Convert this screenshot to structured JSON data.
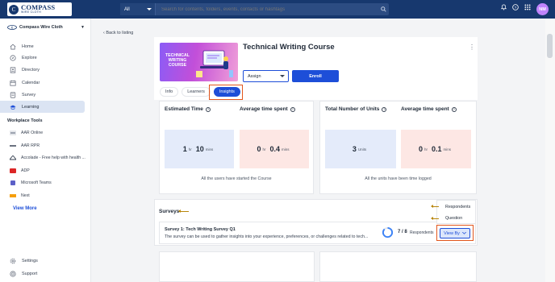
{
  "topbar": {
    "logo_text": "COMPASS",
    "logo_sub": "WIRE CLOTH",
    "search_scope": "All",
    "search_placeholder": "Search for contents, folders, events, contacts or hashtags",
    "avatar_initials": "NM"
  },
  "sidebar": {
    "org_name": "Compass Wire Cloth",
    "nav": [
      {
        "label": "Home",
        "icon": "home-icon"
      },
      {
        "label": "Explore",
        "icon": "explore-icon"
      },
      {
        "label": "Directory",
        "icon": "directory-icon"
      },
      {
        "label": "Calendar",
        "icon": "calendar-icon"
      },
      {
        "label": "Survey",
        "icon": "survey-icon"
      },
      {
        "label": "Learning",
        "icon": "learning-icon",
        "active": true
      }
    ],
    "tools_heading": "Workplace Tools",
    "tools": [
      {
        "label": "AAR Online"
      },
      {
        "label": "AAR RPR"
      },
      {
        "label": "Accolade - Free help with health ..."
      },
      {
        "label": "ADP"
      },
      {
        "label": "Microsoft Teams"
      },
      {
        "label": "Next"
      }
    ],
    "view_more": "View More",
    "settings": "Settings",
    "support": "Support"
  },
  "main": {
    "back_label": "Back to listing",
    "thumb_text": [
      "TECHNICAL",
      "WRITING",
      "COURSE"
    ],
    "course_title": "Technical Writing Course",
    "assign_label": "Assign",
    "enroll_label": "Enroll",
    "tabs": [
      "Info",
      "Learners",
      "Insights"
    ],
    "active_tab": "Insights",
    "stats_left": {
      "estimated_title": "Estimated Time",
      "estimated": {
        "h": "1",
        "h_unit": "hr",
        "m": "10",
        "m_unit": "mins"
      },
      "avg_title": "Average time spent",
      "avg": {
        "h": "0",
        "h_unit": "hr",
        "m": "0.4",
        "m_unit": "mins"
      },
      "note": "All the users have started the Course"
    },
    "stats_right": {
      "units_title": "Total Number of Units",
      "units": {
        "value": "3",
        "unit": "Units"
      },
      "avg_title": "Average time spent",
      "avg": {
        "h": "0",
        "h_unit": "hr",
        "m": "0.1",
        "m_unit": "mins"
      },
      "note": "All the units have been time logged"
    },
    "surveys_heading": "Surveys",
    "survey": {
      "name": "Survey 1: Tech Writing Survey Q1",
      "description": "The survey can be used to gather insights into your experience, preferences, or challenges related to tech...",
      "responded": "7",
      "total": "8",
      "respondents_label": "Respondents",
      "response_fraction": 0.875
    },
    "view_by_label": "View By",
    "view_by_options": [
      "Respondents",
      "Question"
    ]
  },
  "colors": {
    "topbar": "#17386e",
    "primary": "#1d4ed8",
    "highlight": "#e2561d",
    "arrow": "#b8860b"
  }
}
